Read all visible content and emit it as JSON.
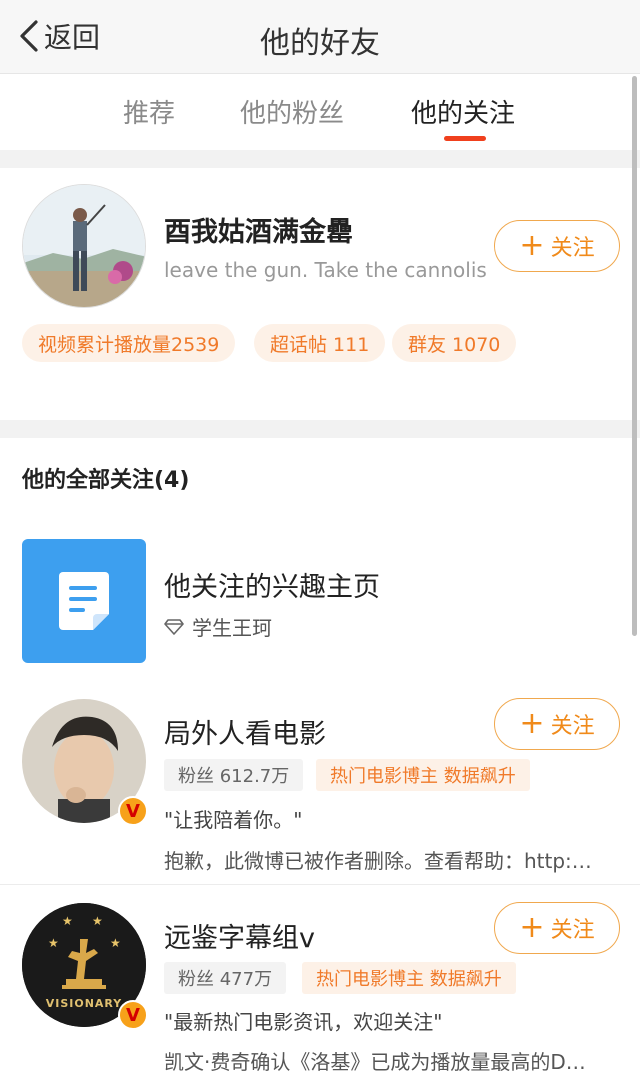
{
  "header": {
    "back_label": "返回",
    "title": "他的好友"
  },
  "tabs": [
    {
      "label": "推荐"
    },
    {
      "label": "他的粉丝"
    },
    {
      "label": "他的关注"
    }
  ],
  "profile": {
    "name": "酉我姑酒满金罍",
    "bio": "leave the gun. Take the cannolis",
    "follow_label": "关注",
    "pills": [
      "视频累计播放量2539",
      "超话帖 111",
      "群友 1070"
    ]
  },
  "section_title": "他的全部关注(4)",
  "interest": {
    "title": "他关注的兴趣主页",
    "subtitle": "学生王珂"
  },
  "users": [
    {
      "name": "局外人看电影",
      "fans": "粉丝 612.7万",
      "tag": "热门电影博主 数据飙升",
      "quote": "\"让我陪着你。\"",
      "desc": "抱歉，此微博已被作者删除。查看帮助：http:…",
      "follow_label": "关注",
      "verify_mark": "V"
    },
    {
      "name": "远鉴字幕组v",
      "fans": "粉丝 477万",
      "tag": "热门电影博主 数据飙升",
      "quote": "\"最新热门电影资讯，欢迎关注\"",
      "desc": "凯文·费奇确认《洛基》已成为播放量最高的D…",
      "follow_label": "关注",
      "verify_mark": "V",
      "logo_text": "VISIONARY"
    }
  ],
  "colors": {
    "accent": "#f08a1a",
    "tab_indicator": "#f0401d",
    "pill_bg": "#fdf1e7",
    "interest_icon_bg": "#3d9fef"
  }
}
